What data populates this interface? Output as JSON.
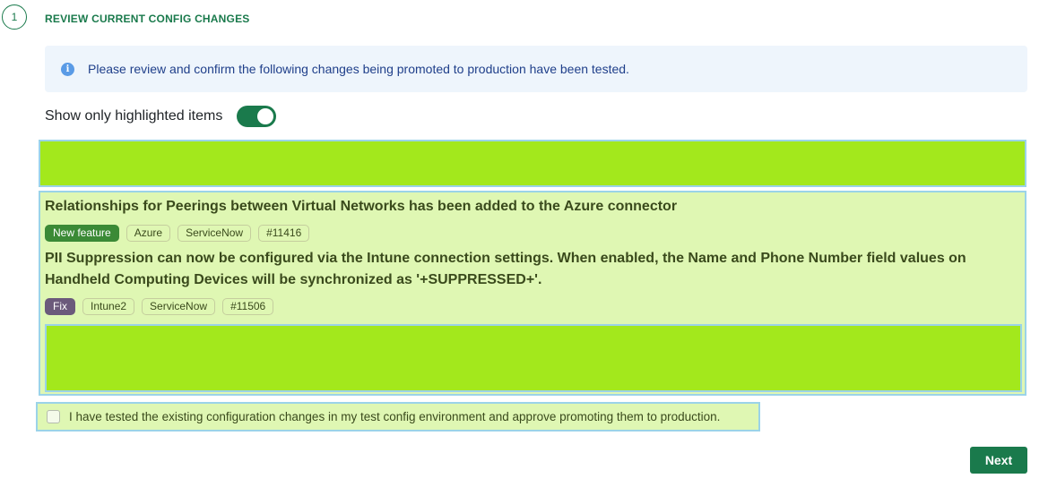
{
  "step": {
    "number": "1",
    "title": "REVIEW CURRENT CONFIG CHANGES"
  },
  "info": {
    "icon": "info-icon",
    "icon_glyph": "i",
    "text": "Please review and confirm the following changes being promoted to production have been tested."
  },
  "filter": {
    "label": "Show only highlighted items",
    "toggle_on": true
  },
  "changes": [
    {
      "title": "Relationships for Peerings between Virtual Networks has been added to the Azure connector",
      "tags": [
        "New feature",
        "Azure",
        "ServiceNow",
        "#11416"
      ]
    },
    {
      "title": "PII Suppression can now be configured via the Intune connection settings. When enabled, the Name and Phone Number field values on Handheld Computing Devices will be synchronized as '+SUPPRESSED+'.",
      "tags": [
        "Fix",
        "Intune2",
        "ServiceNow",
        "#11506"
      ]
    }
  ],
  "approval": {
    "label": "I have tested the existing configuration changes in my test config environment and approve promoting them to production.",
    "checked": false
  },
  "actions": {
    "next_label": "Next"
  },
  "colors": {
    "brand_green": "#1a7a4c",
    "highlight_green": "#a3e81c",
    "highlight_light": "#dff7b3",
    "highlight_border": "#9bd3e8",
    "info_bg": "#eef5fc",
    "tag_new_feature": "#3b8a36",
    "tag_fix": "#6b5a7b"
  }
}
